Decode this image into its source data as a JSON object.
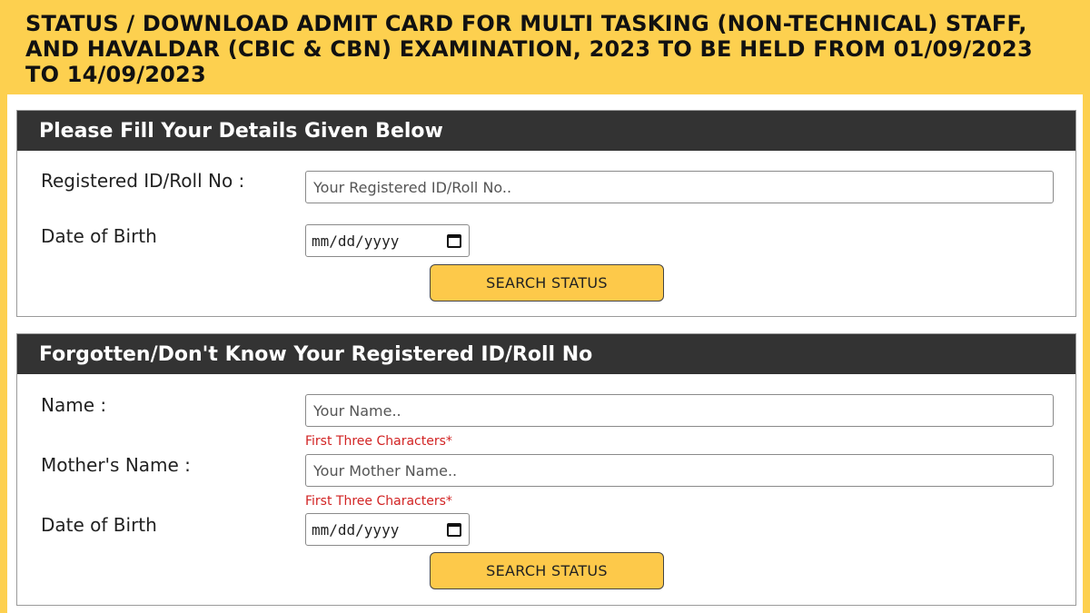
{
  "header": {
    "title": "STATUS / DOWNLOAD ADMIT CARD FOR MULTI TASKING (NON-TECHNICAL) STAFF, AND HAVALDAR (CBIC & CBN) EXAMINATION, 2023 TO BE HELD FROM 01/09/2023 TO 14/09/2023"
  },
  "form1": {
    "heading": "Please Fill Your Details Given Below",
    "id_label": "Registered ID/Roll No :",
    "id_placeholder": "Your Registered ID/Roll No..",
    "dob_label": "Date of Birth",
    "dob_value": "mm/dd/yyyy",
    "button_label": "SEARCH STATUS"
  },
  "form2": {
    "heading": "Forgotten/Don't Know Your Registered ID/Roll No",
    "name_label": "Name :",
    "name_placeholder": "Your Name..",
    "name_hint": "First Three Characters*",
    "mother_label": "Mother's Name :",
    "mother_placeholder": "Your Mother Name..",
    "mother_hint": "First Three Characters*",
    "dob_label": "Date of Birth",
    "dob_value": "mm/dd/yyyy",
    "button_label": "SEARCH STATUS"
  },
  "colors": {
    "banner": "#fdd04f",
    "panel_header": "#333333",
    "button": "#fdc94a",
    "hint": "#d22424"
  }
}
